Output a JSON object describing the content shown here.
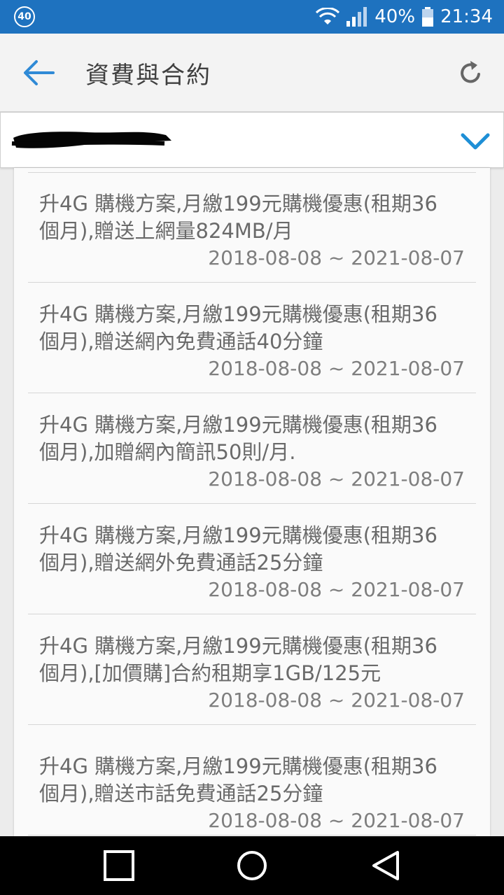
{
  "status_bar": {
    "badge": "40",
    "battery": "40%",
    "time": "21:34"
  },
  "app_bar": {
    "title": "資費與合約",
    "back_icon": "arrow-left-icon",
    "refresh_icon": "refresh-icon"
  },
  "account_select": {
    "value_redacted": true,
    "icon": "chevron-down-icon"
  },
  "plans": [
    {
      "line1": "升4G 購機方案,月繳199元購機優惠(租期36",
      "line2": "個月),贈送上網量824MB/月",
      "period": "2018-08-08 ~ 2021-08-07"
    },
    {
      "line1": "升4G 購機方案,月繳199元購機優惠(租期36",
      "line2": "個月),贈送網內免費通話40分鐘",
      "period": "2018-08-08 ~ 2021-08-07"
    },
    {
      "line1": "升4G 購機方案,月繳199元購機優惠(租期36",
      "line2": "個月),加贈網內簡訊50則/月.",
      "period": "2018-08-08 ~ 2021-08-07"
    },
    {
      "line1": "升4G 購機方案,月繳199元購機優惠(租期36",
      "line2": "個月),贈送網外免費通話25分鐘",
      "period": "2018-08-08 ~ 2021-08-07"
    },
    {
      "line1": "升4G 購機方案,月繳199元購機優惠(租期36",
      "line2": "個月),[加價購]合約租期享1GB/125元",
      "period": "2018-08-08 ~ 2021-08-07"
    },
    {
      "line1": "升4G 購機方案,月繳199元購機優惠(租期36",
      "line2": "個月),贈送市話免費通話25分鐘",
      "period": "2018-08-08 ~ 2021-08-07"
    }
  ],
  "nav_bar": {
    "buttons": [
      "recents-square-icon",
      "home-circle-icon",
      "back-triangle-icon"
    ]
  }
}
